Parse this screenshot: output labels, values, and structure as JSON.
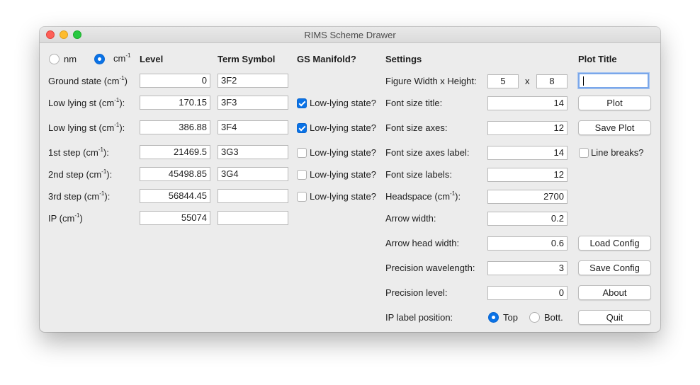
{
  "window": {
    "title": "RIMS Scheme Drawer"
  },
  "unit": {
    "nm_label": "nm",
    "cm_label": "cm",
    "cm_sup": "-1",
    "selected": "cm-1"
  },
  "headers": {
    "level": "Level",
    "term": "Term Symbol",
    "gs": "GS Manifold?",
    "settings": "Settings",
    "plot_title": "Plot Title"
  },
  "rows": [
    {
      "label": "Ground state (cm",
      "sup": "-1",
      "suffix": ")",
      "level": "0",
      "term": "3F2"
    },
    {
      "label": "Low lying st (cm",
      "sup": "-1",
      "suffix": "):",
      "level": "170.15",
      "term": "3F3",
      "checkbox_label": "Low-lying state?",
      "checked": true
    },
    {
      "label": "Low lying st (cm",
      "sup": "-1",
      "suffix": "):",
      "level": "386.88",
      "term": "3F4",
      "checkbox_label": "Low-lying state?",
      "checked": true
    },
    {
      "label": "1st step (cm",
      "sup": "-1",
      "suffix": "):",
      "level": "21469.5",
      "term": "3G3",
      "checkbox_label": "Low-lying state?",
      "checked": false
    },
    {
      "label": "2nd step (cm",
      "sup": "-1",
      "suffix": "):",
      "level": "45498.85",
      "term": "3G4",
      "checkbox_label": "Low-lying state?",
      "checked": false
    },
    {
      "label": "3rd step (cm",
      "sup": "-1",
      "suffix": "):",
      "level": "56844.45",
      "term": "",
      "checkbox_label": "Low-lying state?",
      "checked": false
    },
    {
      "label": "IP (cm",
      "sup": "-1",
      "suffix": ")",
      "level": "55074",
      "term": ""
    }
  ],
  "settings": {
    "fig_label": "Figure Width x Height:",
    "fig_width": "5",
    "fig_x": "x",
    "fig_height": "8",
    "items": [
      {
        "label": "Font size title:",
        "value": "14"
      },
      {
        "label": "Font size axes:",
        "value": "12"
      },
      {
        "label": "Font size axes label:",
        "value": "14"
      },
      {
        "label": "Font size labels:",
        "value": "12"
      },
      {
        "label": "Headspace (cm",
        "sup": "-1",
        "suffix": "):",
        "value": "2700"
      },
      {
        "label": "Arrow width:",
        "value": "0.2"
      },
      {
        "label": "Arrow head width:",
        "value": "0.6"
      },
      {
        "label": "Precision wavelength:",
        "value": "3"
      },
      {
        "label": "Precision level:",
        "value": "0"
      }
    ],
    "ip_label": "IP label position:",
    "ip_top": "Top",
    "ip_bott": "Bott.",
    "ip_selected": "Top"
  },
  "right": {
    "plot_title_value": "",
    "plot_button": "Plot",
    "save_plot_button": "Save Plot",
    "line_breaks_label": "Line breaks?",
    "line_breaks_checked": false,
    "load_config_button": "Load Config",
    "save_config_button": "Save Config",
    "about_button": "About",
    "quit_button": "Quit"
  }
}
